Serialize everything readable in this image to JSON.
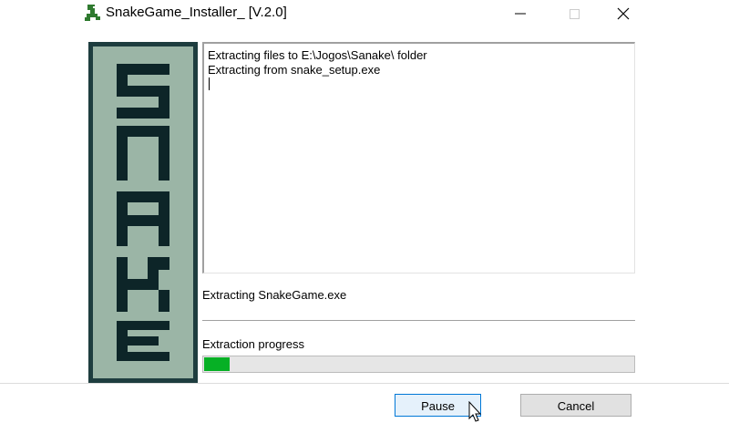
{
  "window": {
    "title": "SnakeGame_Installer_ [V.2.0]",
    "icon": "snake-icon",
    "controls": [
      "minimize-icon",
      "maximize-icon",
      "close-icon"
    ]
  },
  "banner": {
    "text": "SNAKE",
    "background_color": "#9bb5a6",
    "frame_color": "#1e3d3f",
    "letter_color": "#0d2528"
  },
  "log": {
    "lines": [
      "Extracting files to E:\\Jogos\\Sanake\\ folder",
      "Extracting from snake_setup.exe"
    ]
  },
  "status": {
    "text": "Extracting SnakeGame.exe"
  },
  "progress": {
    "label": "Extraction progress",
    "percent": 6,
    "color": "#06b025"
  },
  "buttons": {
    "pause_label": "Pause",
    "cancel_label": "Cancel"
  }
}
